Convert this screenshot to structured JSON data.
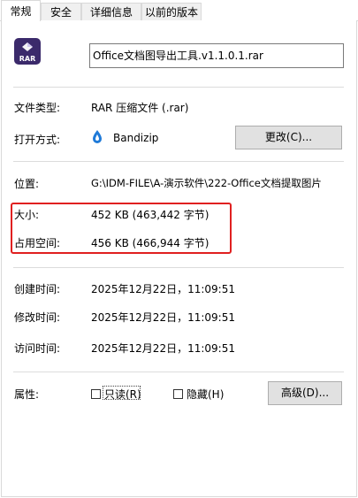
{
  "tabs": [
    {
      "label": "常规",
      "active": true
    },
    {
      "label": "安全",
      "active": false
    },
    {
      "label": "详细信息",
      "active": false
    },
    {
      "label": "以前的版本",
      "active": false
    }
  ],
  "file": {
    "name": "Office文档图导出工具.v1.1.0.1.rar",
    "icon_text": "RAR"
  },
  "type": {
    "label": "文件类型:",
    "value": "RAR 压缩文件 (.rar)"
  },
  "opens_with": {
    "label": "打开方式:",
    "app": "Bandizip",
    "change_button": "更改(C)..."
  },
  "location": {
    "label": "位置:",
    "value": "G:\\IDM-FILE\\A-演示软件\\222-Office文档提取图片"
  },
  "size": {
    "label": "大小:",
    "value": "452 KB (463,442 字节)"
  },
  "size_on_disk": {
    "label": "占用空间:",
    "value": "456 KB (466,944 字节)"
  },
  "created": {
    "label": "创建时间:",
    "value": "2025年12月22日，11:09:51"
  },
  "modified": {
    "label": "修改时间:",
    "value": "2025年12月22日，11:09:51"
  },
  "accessed": {
    "label": "访问时间:",
    "value": "2025年12月22日，11:09:51"
  },
  "attributes": {
    "label": "属性:",
    "readonly": "只读(R)",
    "hidden": "隐藏(H)",
    "advanced_button": "高级(D)..."
  },
  "colors": {
    "highlight": "#e02020",
    "rar_icon": "#3b2a6b",
    "bandizip": "#1f7ad8"
  }
}
